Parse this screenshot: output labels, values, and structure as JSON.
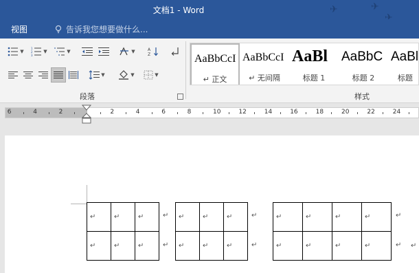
{
  "app": {
    "title": "文档1 - Word"
  },
  "tabs": {
    "view": "视图"
  },
  "tell_me": {
    "placeholder": "告诉我您想要做什么..."
  },
  "ribbon": {
    "paragraph_group_label": "段落",
    "styles_group_label": "样式",
    "styles": [
      {
        "sample": "AaBbCcI",
        "name": "↵ 正文"
      },
      {
        "sample": "AaBbCcI",
        "name": "↵ 无间隔"
      },
      {
        "sample": "AaBl",
        "name": "标题 1"
      },
      {
        "sample": "AaBbC",
        "name": "标题 2"
      },
      {
        "sample": "AaBl",
        "name": "标题"
      }
    ]
  },
  "ruler": {
    "left_labels": [
      "6",
      "4",
      "2"
    ],
    "right_labels": [
      "2",
      "4",
      "6",
      "8",
      "10",
      "12",
      "14",
      "16",
      "18",
      "20",
      "22",
      "24"
    ]
  },
  "document": {
    "paragraph_mark": "↵",
    "tables": [
      {
        "rows": 2,
        "cols": 3,
        "cells": [
          [
            "↵",
            "↵",
            "↵"
          ],
          [
            "↵",
            "↵",
            "↵"
          ]
        ]
      },
      {
        "rows": 2,
        "cols": 3,
        "cells": [
          [
            "↵",
            "↵",
            "↵"
          ],
          [
            "↵",
            "↵",
            "↵"
          ]
        ]
      },
      {
        "rows": 2,
        "cols": 4,
        "cells": [
          [
            "↵",
            "↵",
            "↵",
            "↵"
          ],
          [
            "↵",
            "↵",
            "↵",
            "↵"
          ]
        ]
      }
    ]
  },
  "colors": {
    "titlebar": "#2b579a",
    "ribbon_bg": "#f3f3f3",
    "page_bg": "#ffffff"
  }
}
